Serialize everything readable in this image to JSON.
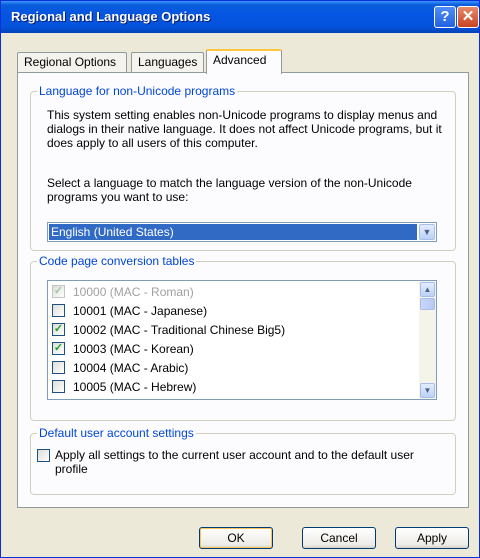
{
  "window": {
    "title": "Regional and Language Options",
    "help_glyph": "?",
    "close_glyph": "✕"
  },
  "tabs": [
    {
      "label": "Regional Options",
      "active": false
    },
    {
      "label": "Languages",
      "active": false
    },
    {
      "label": "Advanced",
      "active": true
    }
  ],
  "non_unicode": {
    "legend": "Language for non-Unicode programs",
    "description": "This system setting enables non-Unicode programs to display menus and dialogs in their native language. It does not affect Unicode programs, but it does apply to all users of this computer.",
    "select_prompt": "Select a language to match the language version of the non-Unicode programs you want to use:",
    "selected_language": "English (United States)"
  },
  "code_pages": {
    "legend": "Code page conversion tables",
    "items": [
      {
        "label": "10000 (MAC - Roman)",
        "checked": true,
        "disabled": true
      },
      {
        "label": "10001 (MAC - Japanese)",
        "checked": false,
        "disabled": false
      },
      {
        "label": "10002 (MAC - Traditional Chinese Big5)",
        "checked": true,
        "disabled": false
      },
      {
        "label": "10003 (MAC - Korean)",
        "checked": true,
        "disabled": false
      },
      {
        "label": "10004 (MAC - Arabic)",
        "checked": false,
        "disabled": false
      },
      {
        "label": "10005 (MAC - Hebrew)",
        "checked": false,
        "disabled": false
      }
    ]
  },
  "default_user": {
    "legend": "Default user account settings",
    "checkbox_label": "Apply all settings to the current user account and to the default user profile",
    "checked": false
  },
  "buttons": {
    "ok": "OK",
    "cancel": "Cancel",
    "apply": "Apply"
  },
  "colors": {
    "titlebar": "#0554e3",
    "legend_text": "#0046d5",
    "selection": "#316ac5",
    "active_tab_accent": "#ffc83c"
  }
}
